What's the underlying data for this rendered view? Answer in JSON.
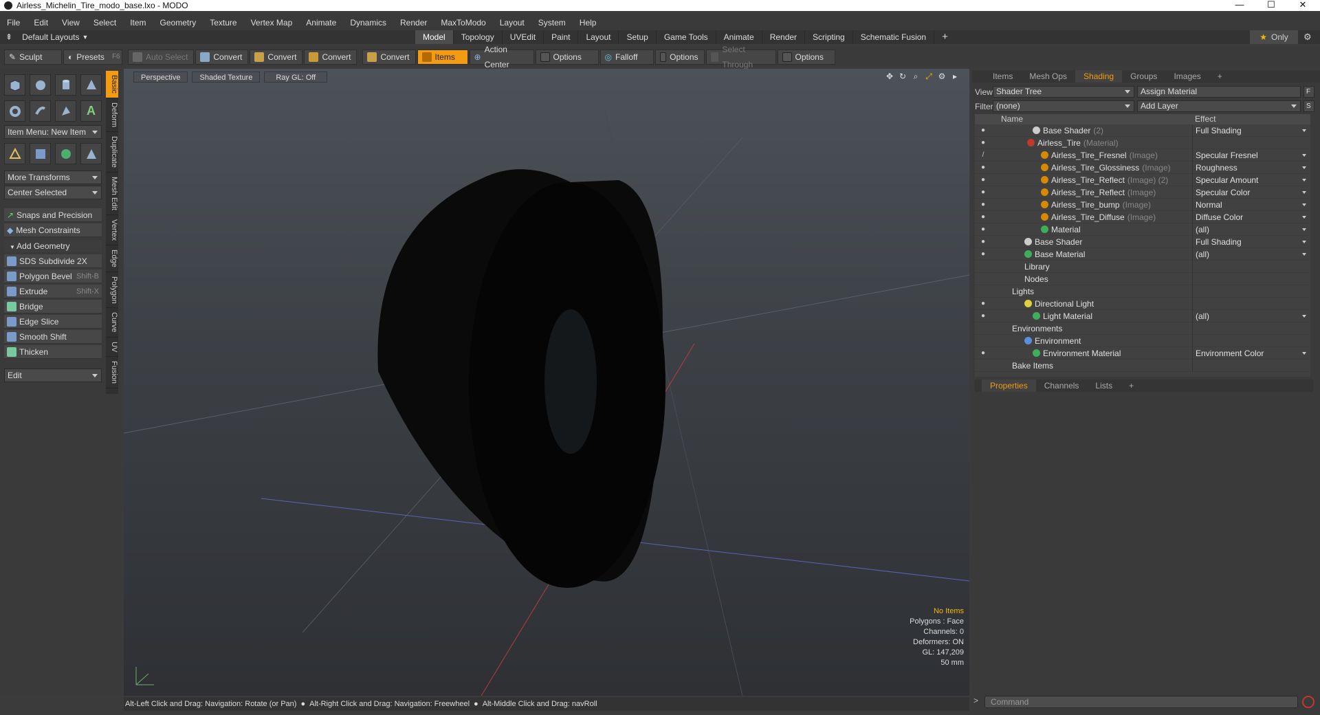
{
  "window": {
    "title": "Airless_Michelin_Tire_modo_base.lxo - MODO",
    "min": "—",
    "max": "☐",
    "close": "✕"
  },
  "menu": [
    "File",
    "Edit",
    "View",
    "Select",
    "Item",
    "Geometry",
    "Texture",
    "Vertex Map",
    "Animate",
    "Dynamics",
    "Render",
    "MaxToModo",
    "Layout",
    "System",
    "Help"
  ],
  "layout": {
    "name": "Default Layouts",
    "only": "Only"
  },
  "modes": [
    "Model",
    "Topology",
    "UVEdit",
    "Paint",
    "Layout",
    "Setup",
    "Game Tools",
    "Animate",
    "Render",
    "Scripting",
    "Schematic Fusion"
  ],
  "toolbar": {
    "sculpt": "Sculpt",
    "presets": "Presets",
    "presets_key": "F6",
    "auto_select": "Auto Select",
    "convert1": "Convert",
    "convert2": "Convert",
    "convert3": "Convert",
    "convert4": "Convert",
    "items": "Items",
    "action_center": "Action Center",
    "options1": "Options",
    "falloff": "Falloff",
    "options2": "Options",
    "select_through": "Select Through",
    "options3": "Options"
  },
  "left": {
    "item_menu": "Item Menu: New Item",
    "more_transforms": "More Transforms",
    "center_selected": "Center Selected",
    "snaps": "Snaps and Precision",
    "mesh_constraints": "Mesh Constraints",
    "add_geometry": "Add Geometry",
    "tools": [
      {
        "label": "SDS Subdivide 2X",
        "key": ""
      },
      {
        "label": "Polygon Bevel",
        "key": "Shift-B"
      },
      {
        "label": "Extrude",
        "key": "Shift-X"
      },
      {
        "label": "Bridge",
        "key": ""
      },
      {
        "label": "Edge Slice",
        "key": ""
      },
      {
        "label": "Smooth Shift",
        "key": ""
      },
      {
        "label": "Thicken",
        "key": ""
      }
    ],
    "edit": "Edit"
  },
  "vtabs": [
    "Basic",
    "Deform",
    "Duplicate",
    "Mesh Edit",
    "Vertex",
    "Edge",
    "Polygon",
    "Curve",
    "UV",
    "Fusion"
  ],
  "viewport": {
    "view": "Perspective",
    "shading": "Shaded Texture",
    "raygl": "Ray GL: Off"
  },
  "stats": {
    "items": "No Items",
    "polygons": "Polygons : Face",
    "channels": "Channels: 0",
    "deformers": "Deformers: ON",
    "gl": "GL: 147,209",
    "lens": "50 mm"
  },
  "status": [
    "Alt-Left Click and Drag: Navigation: Rotate (or Pan)",
    "Alt-Right Click and Drag: Navigation: Freewheel",
    "Alt-Middle Click and Drag: navRoll"
  ],
  "right": {
    "tabs": [
      "Items",
      "Mesh Ops",
      "Shading",
      "Groups",
      "Images"
    ],
    "view_label": "View",
    "view_value": "Shader Tree",
    "assign": "Assign Material",
    "filter_label": "Filter",
    "filter_value": "(none)",
    "add_layer": "Add Layer",
    "col_name": "Name",
    "col_effect": "Effect",
    "rows": [
      {
        "name": "Base Shader",
        "suffix": "(2)",
        "effect": "Full Shading",
        "indent": 56,
        "color": "#cccccc",
        "eye": "●"
      },
      {
        "name": "Airless_Tire",
        "suffix": "(Material)",
        "effect": "",
        "indent": 48,
        "color": "#c0392b",
        "eye": "●"
      },
      {
        "name": "Airless_Tire_Fresnel",
        "suffix": "(Image)",
        "effect": "Specular Fresnel",
        "indent": 68,
        "color": "#d68a00",
        "eye": "/"
      },
      {
        "name": "Airless_Tire_Glossiness",
        "suffix": "(Image)",
        "effect": "Roughness",
        "indent": 68,
        "color": "#d68a00",
        "eye": "●"
      },
      {
        "name": "Airless_Tire_Reflect",
        "suffix": "(Image) (2)",
        "effect": "Specular Amount",
        "indent": 68,
        "color": "#d68a00",
        "eye": "●"
      },
      {
        "name": "Airless_Tire_Reflect",
        "suffix": "(Image)",
        "effect": "Specular Color",
        "indent": 68,
        "color": "#d68a00",
        "eye": "●"
      },
      {
        "name": "Airless_Tire_bump",
        "suffix": "(Image)",
        "effect": "Normal",
        "indent": 68,
        "color": "#d68a00",
        "eye": "●"
      },
      {
        "name": "Airless_Tire_Diffuse",
        "suffix": "(Image)",
        "effect": "Diffuse Color",
        "indent": 68,
        "color": "#d68a00",
        "eye": "●"
      },
      {
        "name": "Material",
        "suffix": "",
        "effect": "(all)",
        "indent": 68,
        "color": "#3fae5b",
        "eye": "●"
      },
      {
        "name": "Base Shader",
        "suffix": "",
        "effect": "Full Shading",
        "indent": 44,
        "color": "#cccccc",
        "eye": "●"
      },
      {
        "name": "Base Material",
        "suffix": "",
        "effect": "(all)",
        "indent": 44,
        "color": "#3fae5b",
        "eye": "●"
      },
      {
        "name": "Library",
        "suffix": "",
        "effect": "",
        "indent": 44,
        "color": "",
        "eye": ""
      },
      {
        "name": "Nodes",
        "suffix": "",
        "effect": "",
        "indent": 44,
        "color": "",
        "eye": ""
      },
      {
        "name": "Lights",
        "suffix": "",
        "effect": "",
        "indent": 26,
        "color": "",
        "eye": ""
      },
      {
        "name": "Directional Light",
        "suffix": "",
        "effect": "",
        "indent": 44,
        "color": "#e0d040",
        "eye": "●"
      },
      {
        "name": "Light Material",
        "suffix": "",
        "effect": "(all)",
        "indent": 56,
        "color": "#3fae5b",
        "eye": "●"
      },
      {
        "name": "Environments",
        "suffix": "",
        "effect": "",
        "indent": 26,
        "color": "",
        "eye": ""
      },
      {
        "name": "Environment",
        "suffix": "",
        "effect": "",
        "indent": 44,
        "color": "#5b8fd8",
        "eye": ""
      },
      {
        "name": "Environment Material",
        "suffix": "",
        "effect": "Environment Color",
        "indent": 56,
        "color": "#3fae5b",
        "eye": "●"
      },
      {
        "name": "Bake Items",
        "suffix": "",
        "effect": "",
        "indent": 26,
        "color": "",
        "eye": ""
      }
    ],
    "ptabs": [
      "Properties",
      "Channels",
      "Lists"
    ],
    "command": "Command"
  }
}
